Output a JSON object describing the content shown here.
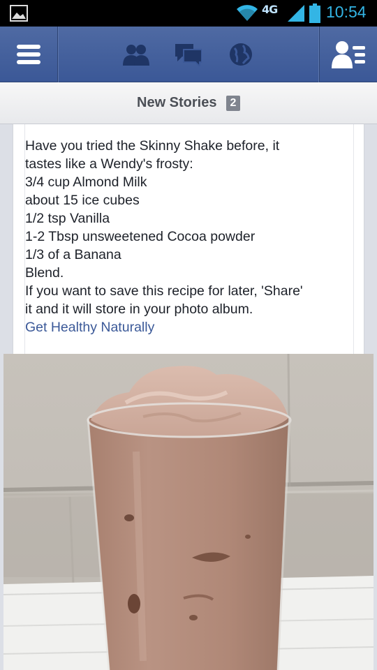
{
  "status_bar": {
    "network": "4G",
    "time": "10:54",
    "icons": [
      "gallery-icon",
      "wifi-icon",
      "signal-icon",
      "battery-icon"
    ],
    "accent_color": "#33b5e5"
  },
  "top_bar": {
    "icons": [
      "menu-icon",
      "friend-requests-icon",
      "messages-icon",
      "notifications-globe-icon",
      "friends-list-icon"
    ],
    "brand_color": "#3b5998"
  },
  "new_stories": {
    "label": "New Stories",
    "count": "2"
  },
  "post": {
    "lines": [
      "Have you tried the Skinny Shake before, it",
      "tastes like a Wendy's frosty:",
      "3/4 cup Almond Milk",
      "about 15 ice cubes",
      "1/2 tsp Vanilla",
      "1-2 Tbsp unsweetened Cocoa powder",
      "1/3 of a Banana",
      "Blend.",
      "If you want to save this recipe for later, 'Share'",
      "it and it will store in your photo album."
    ],
    "page_link": "Get Healthy Naturally"
  }
}
